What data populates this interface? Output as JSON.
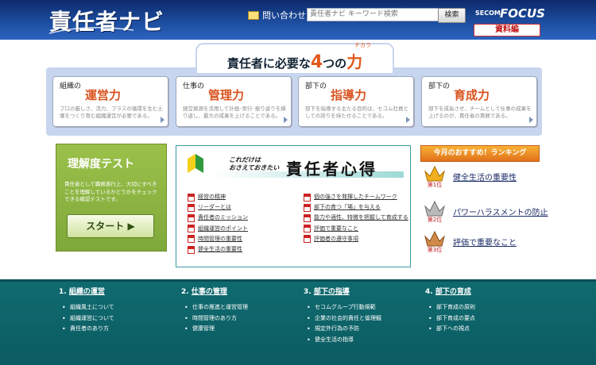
{
  "header": {
    "logo": "責任者ナビ",
    "contact": "問い合わせ",
    "search_placeholder": "責任者ナビ キーワード検索",
    "search_button": "検索",
    "secom": "SECOM",
    "focus": "FOCUS",
    "materials": "資料編"
  },
  "four": {
    "title_pre": "責任者に必要な",
    "title_num": "4",
    "title_mid": "つの",
    "title_ka": "力",
    "ruby": "チカラ",
    "cards": [
      {
        "sub": "組織の",
        "title": "運営力",
        "text": "プロの厳しさ、活力、プラスの循環を生む土壌をつくり育む組織運営が必要である。"
      },
      {
        "sub": "仕事の",
        "title": "管理力",
        "text": "経営資源を活用して計画･実行･振り返りを繰り返し、最大の成果を上げることである。"
      },
      {
        "sub": "部下の",
        "title": "指導力",
        "text": "部下を指導する主たる目的は、セコム社員としての誇りを持たせることである。"
      },
      {
        "sub": "部下の",
        "title": "育成力",
        "text": "部下を成長させ、チームとして仕事の成果を上げるのが、責任者の責務である。"
      }
    ]
  },
  "test": {
    "title": "理解度テスト",
    "text": "責任者として職務遂行上、大切にすべきことを理解しているかどうかをチェックできる確認テストです。",
    "start": "スタート ▶"
  },
  "kokoroe": {
    "sub1": "これだけは",
    "sub2": "おさえておきたい",
    "title": "責任者心得",
    "left": [
      "経営の精神",
      "リーダーとは",
      "責任者のミッション",
      "組織運営のポイント",
      "時間管理の重要性",
      "健全生活の重要性"
    ],
    "right": [
      "個の強さを発揮したチームワーク",
      "部下の育つ「場」を与える",
      "能力や適性、特徴を把握して育成する",
      "評価で重要なこと",
      "評価者の遵守事項"
    ]
  },
  "ranking": {
    "head": "今月のおすすめ！ランキング",
    "items": [
      {
        "rank": "第1位",
        "label": "健全生活の重要性"
      },
      {
        "rank": "第2位",
        "label": "パワーハラスメントの防止"
      },
      {
        "rank": "第3位",
        "label": "評価で重要なこと"
      }
    ]
  },
  "footer": {
    "cols": [
      {
        "num": "1.",
        "title": "組織の運営",
        "items": [
          "組織風土について",
          "組織運営について",
          "責任者のあり方"
        ]
      },
      {
        "num": "2.",
        "title": "仕事の管理",
        "items": [
          "仕事の推進と運営管理",
          "時間管理のあり方",
          "健康管理"
        ]
      },
      {
        "num": "3.",
        "title": "部下の指導",
        "items": [
          "セコムグループ行動規範",
          "企業の社会的責任と倫理観",
          "規定外行為の予防",
          "健全生活の指導"
        ]
      },
      {
        "num": "4.",
        "title": "部下の育成",
        "items": [
          "部下育成の原則",
          "部下育成の要点",
          "部下への視点"
        ]
      }
    ]
  },
  "colors": {
    "header": "#1e4fa3",
    "accent": "#e2591b",
    "green": "#8db544",
    "teal": "#0f6a6f",
    "ranking": "#f0922a"
  }
}
